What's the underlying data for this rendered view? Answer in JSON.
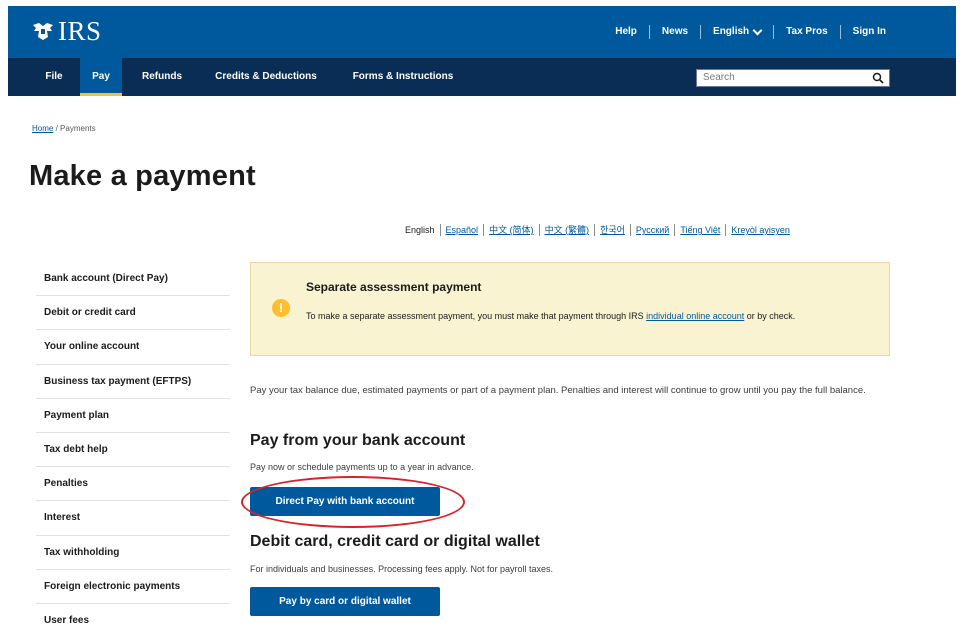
{
  "header": {
    "logo_text": "IRS",
    "util_links": [
      "Help",
      "News",
      "English",
      "Tax Pros",
      "Sign In"
    ],
    "nav": [
      "File",
      "Pay",
      "Refunds",
      "Credits & Deductions",
      "Forms & Instructions"
    ],
    "active_nav": "Pay",
    "search_placeholder": "Search",
    "brand_color": "#00599c",
    "nav_color": "#0a2d55"
  },
  "breadcrumb": {
    "home": "Home",
    "separator": "/",
    "current": "Payments"
  },
  "page_title": "Make a payment",
  "languages": [
    "English",
    "Español",
    "中文 (简体)",
    "中文 (繁體)",
    "한국어",
    "Русский",
    "Tiếng Việt",
    "Kreyòl ayisyen"
  ],
  "sidebar": {
    "items": [
      "Bank account (Direct Pay)",
      "Debit or credit card",
      "Your online account",
      "Business tax payment (EFTPS)",
      "Payment plan",
      "Tax debt help",
      "Penalties",
      "Interest",
      "Tax withholding",
      "Foreign electronic payments",
      "User fees"
    ]
  },
  "alert": {
    "heading": "Separate assessment payment",
    "body_before": "To make a separate assessment payment, you must make that payment through IRS ",
    "body_link": "individual online account",
    "body_after": " or by check.",
    "icon": "warning-icon",
    "bg_color": "#faf3d1"
  },
  "intro": "Pay your tax balance due, estimated payments or part of a payment plan. Penalties and interest will continue to grow until you pay the full balance.",
  "bank_section": {
    "heading": "Pay from your bank account",
    "sub": "Pay now or schedule payments up to a year in advance.",
    "button": "Direct Pay with bank account"
  },
  "card_section": {
    "heading": "Debit card, credit card or digital wallet",
    "sub": "For individuals and businesses. Processing fees apply. Not for payroll taxes.",
    "button": "Pay by card or digital wallet"
  },
  "highlight_color": "#d8232a"
}
